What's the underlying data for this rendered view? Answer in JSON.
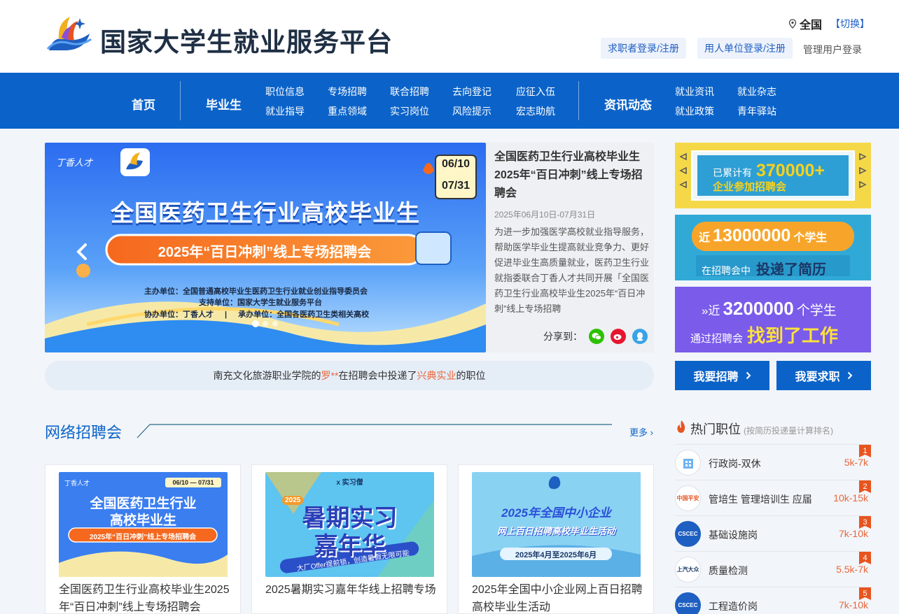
{
  "header": {
    "site_title": "国家大学生就业服务平台",
    "region": "全国",
    "switch": "【切换】",
    "seeker_login": "求职者登录/注册",
    "employer_login": "用人单位登录/注册",
    "admin_login": "管理用户登录"
  },
  "nav": {
    "home": "首页",
    "graduates": "毕业生",
    "row1": [
      "职位信息",
      "专场招聘",
      "联合招聘",
      "去向登记",
      "应征入伍"
    ],
    "row2": [
      "就业指导",
      "重点领域",
      "实习岗位",
      "风险提示",
      "宏志助航"
    ],
    "news": "资讯动态",
    "news_row1": [
      "就业资讯",
      "就业杂志"
    ],
    "news_row2": [
      "就业政策",
      "青年驿站"
    ]
  },
  "banner": {
    "brand": "丁香人才",
    "date_top": "06/10",
    "date_bottom": "07/31",
    "headline": "全国医药卫生行业高校毕业生",
    "subheadline": "2025年“百日冲刺”线上专场招聘会",
    "org1_label": "主办单位：",
    "org1": "全国普通高校毕业生医药卫生行业就业创业指导委员会",
    "org2_label": "支持单位：",
    "org2": "国家大学生就业服务平台",
    "org3_label": "协办单位：",
    "org3": "丁香人才",
    "org4_label": "承办单位：",
    "org4": "全国各医药卫生类相关高校"
  },
  "banner_info": {
    "title": "全国医药卫生行业高校毕业生2025年“百日冲刺”线上专场招聘会",
    "date": "2025年06月10日-07月31日",
    "desc": "为进一步加强医学高校就业指导服务，帮助医学毕业生提高就业竞争力、更好促进毕业生高质量就业，医药卫生行业就指委联合丁香人才共同开展「全国医药卫生行业高校毕业生2025年“百日冲刺”线上专场招聘",
    "share_label": "分享到："
  },
  "ticker": {
    "school": "南充文化旅游职业学院的",
    "name": "罗**",
    "mid": "在招聘会中投递了",
    "company": "兴典实业",
    "end": "的职位"
  },
  "ads": {
    "ad1_pre": "已累计有",
    "ad1_num": "370000+",
    "ad1_post": "企业参加招聘会",
    "ad2_pre": "近",
    "ad2_num": "13000000",
    "ad2_unit": "个学生",
    "ad2_l2a": "在招聘会中",
    "ad2_l2b": "投递了简历",
    "ad3_pre": "»近",
    "ad3_num": "3200000",
    "ad3_unit": "个学生",
    "ad3_l2a": "通过招聘会",
    "ad3_l2b": "找到了工作"
  },
  "cta": {
    "recruit": "我要招聘",
    "job": "我要求职"
  },
  "section": {
    "title": "网络招聘会",
    "more": "更多"
  },
  "cards": [
    {
      "title": "全国医药卫生行业高校毕业生2025年“百日冲刺”线上专场招聘会",
      "thumb_brand": "丁香人才",
      "thumb_date": "06/10 — 07/31",
      "thumb_l1": "全国医药卫生行业",
      "thumb_l2": "高校毕业生",
      "thumb_l3": "2025年“百日冲刺”线上专场招聘会"
    },
    {
      "title": "2025暑期实习嘉年华线上招聘专场",
      "thumb_top": "x 实习僧",
      "thumb_year": "2025",
      "thumb_l1": "暑期实习",
      "thumb_l2": "嘉年华",
      "thumb_l3": "大厂Offer提前锁，创造暑假无限可能"
    },
    {
      "title": "2025年全国中小企业网上百日招聘高校毕业生活动",
      "thumb_l1": "2025年全国中小企业",
      "thumb_l2": "网上百日招聘高校毕业生活动",
      "thumb_l3": "2025年4月至2025年6月"
    }
  ],
  "hot": {
    "title": "热门职位",
    "subtitle": "(按简历投递量计算排名)",
    "jobs": [
      {
        "rank": "1",
        "name": "行政岗-双休",
        "salary": "5k-7k",
        "logo": ""
      },
      {
        "rank": "2",
        "name": "管培生 管理培训生 应届",
        "salary": "10k-15k",
        "logo": "中国平安"
      },
      {
        "rank": "3",
        "name": "基础设施岗",
        "salary": "7k-10k",
        "logo": "CSCEC"
      },
      {
        "rank": "4",
        "name": "质量检测",
        "salary": "5.5k-7k",
        "logo": "上汽大众"
      },
      {
        "rank": "5",
        "name": "工程造价岗",
        "salary": "7k-10k",
        "logo": "CSCEC"
      }
    ]
  },
  "colors": {
    "primary": "#0b63c9",
    "accent": "#e8673a",
    "nav_bg": "#0b63c9"
  }
}
